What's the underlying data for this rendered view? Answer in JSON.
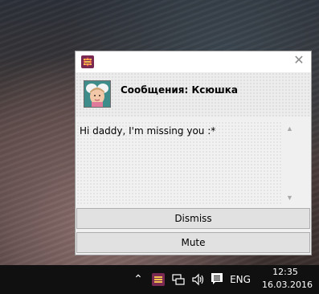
{
  "notification": {
    "sender_title": "Сообщения: Ксюшка",
    "message": "Hi daddy, I'm missing you :*",
    "close_glyph": "✕",
    "buttons": {
      "dismiss": "Dismiss",
      "mute": "Mute"
    },
    "icons": {
      "app": "chat-app-icon",
      "close": "close-icon",
      "avatar": "contact-avatar",
      "scroll_up": "chevron-up-icon",
      "scroll_down": "chevron-down-icon"
    },
    "colors": {
      "app_icon_bg": "#7a2a52",
      "avatar_bg": "#3f8d8a"
    }
  },
  "taskbar": {
    "overflow_glyph": "⌃",
    "language": "ENG",
    "time": "12:35",
    "date": "16.03.2016",
    "icons": [
      "show-hidden-icons",
      "chat-app-tray-icon",
      "network-icon",
      "volume-icon",
      "action-center-icon"
    ]
  }
}
